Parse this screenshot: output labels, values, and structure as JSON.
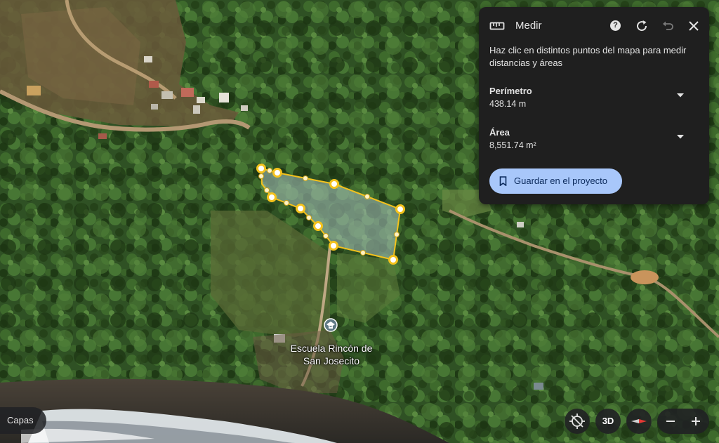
{
  "map": {
    "place_label": "Escuela Rincón de San Josecito",
    "polygon_fill": "#9fb9b3",
    "polygon_stroke": "#f4c21c"
  },
  "measure_panel": {
    "title": "Medir",
    "instructions": "Haz clic en distintos puntos del mapa para medir distancias y áreas",
    "perimeter_label": "Perímetro",
    "perimeter_value": "438.14 m",
    "area_label": "Área",
    "area_value": "8,551.74 m²",
    "save_button": "Guardar en el proyecto",
    "accent_color": "#a8c7fa",
    "background_color": "#1f1f1f"
  },
  "controls": {
    "layers_label": "Capas",
    "view_3d_label": "3D"
  },
  "icons": {
    "ruler": "ruler-icon",
    "help": "help-icon",
    "refresh": "refresh-icon",
    "undo": "undo-icon",
    "close": "close-icon",
    "chevron": "chevron-down-icon",
    "bookmark": "bookmark-icon",
    "location": "location-off-icon",
    "compass": "compass-icon",
    "zoom_out": "minus-icon",
    "zoom_in": "plus-icon",
    "school": "school-pin-icon"
  }
}
